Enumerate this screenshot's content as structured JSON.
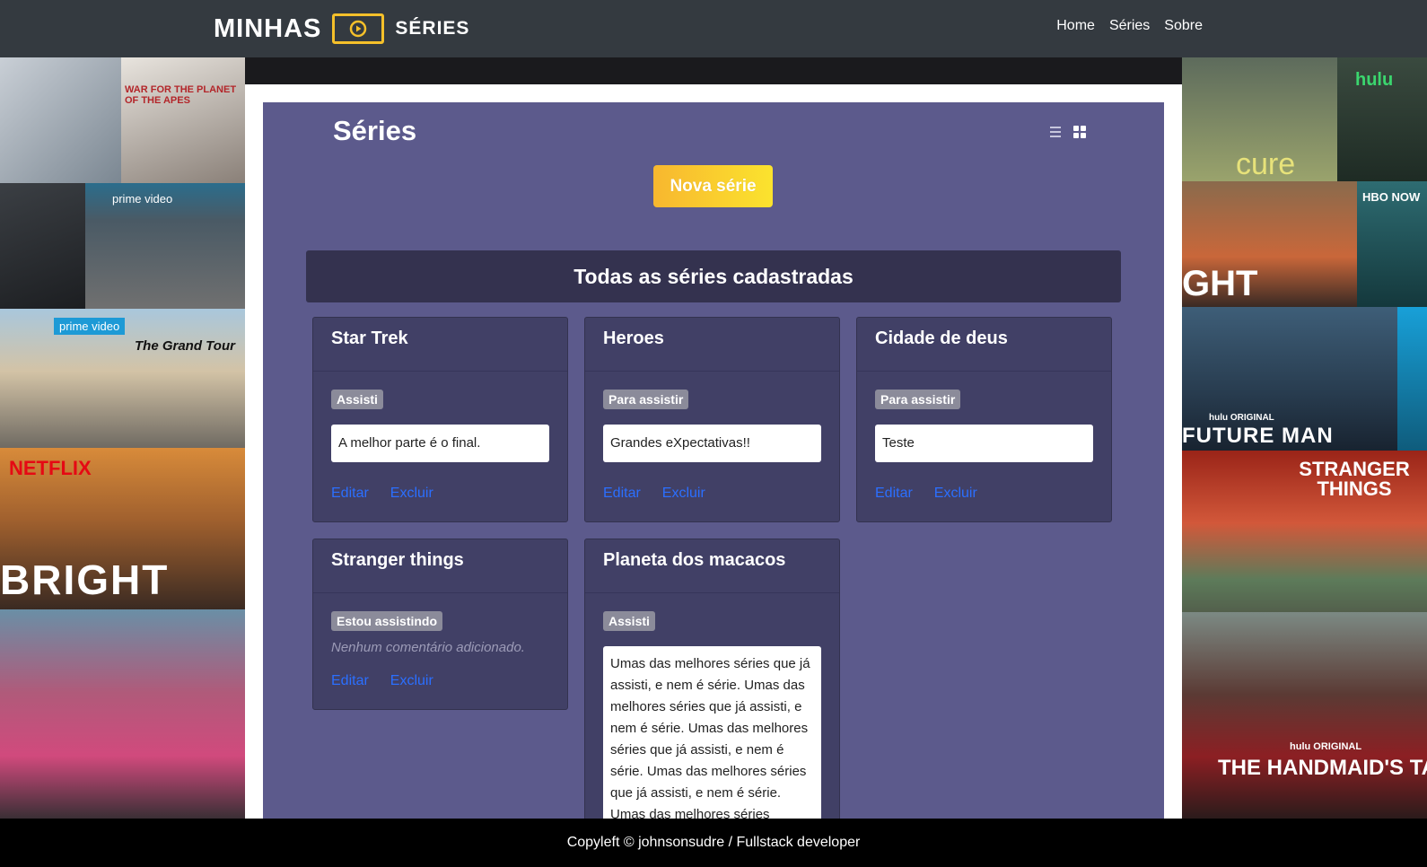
{
  "brand": {
    "left": "MINHAS",
    "right": "SÉRIES",
    "accent": "#f5c02a"
  },
  "nav": [
    {
      "label": "Home"
    },
    {
      "label": "Séries"
    },
    {
      "label": "Sobre"
    }
  ],
  "background_posters": {
    "left": [
      "WAR FOR THE PLANET OF THE APES",
      "prime video",
      "prime video",
      "The Grand Tour",
      "NETFLIX",
      "BRIGHT"
    ],
    "right": [
      "hulu",
      "HBO NOW",
      "hulu ORIGINAL",
      "FUTURE MAN",
      "STRANGER THINGS",
      "hulu ORIGINAL",
      "THE HANDMAID'S TALE"
    ]
  },
  "page": {
    "title": "Séries",
    "new_button": "Nova série",
    "section_title": "Todas as séries cadastradas",
    "view_toggle": {
      "list_icon": "list-icon",
      "grid_icon": "grid-icon"
    }
  },
  "series": [
    {
      "title": "Star Trek",
      "status": "Assisti",
      "comment": "A melhor parte é o final.",
      "edit": "Editar",
      "delete": "Excluir"
    },
    {
      "title": "Heroes",
      "status": "Para assistir",
      "comment": "Grandes eXpectativas!!",
      "edit": "Editar",
      "delete": "Excluir"
    },
    {
      "title": "Cidade de deus",
      "status": "Para assistir",
      "comment": "Teste",
      "edit": "Editar",
      "delete": "Excluir"
    },
    {
      "title": "Stranger things",
      "status": "Estou assistindo",
      "empty_comment": "Nenhum comentário adicionado.",
      "edit": "Editar",
      "delete": "Excluir"
    },
    {
      "title": "Planeta dos macacos",
      "status": "Assisti",
      "comment": "Umas das melhores séries que já assisti, e nem é série. Umas das melhores séries que já assisti, e nem é série. Umas das melhores séries que já assisti, e nem é série. Umas das melhores séries que já assisti, e nem é série. Umas das melhores séries"
    }
  ],
  "footer": {
    "text": "Copyleft © johnsonsudre / Fullstack developer"
  },
  "colors": {
    "panel": "#5c5a8c",
    "card": "#414066",
    "header": "#34324f",
    "link": "#2b6fff",
    "navbar": "#343a40"
  }
}
